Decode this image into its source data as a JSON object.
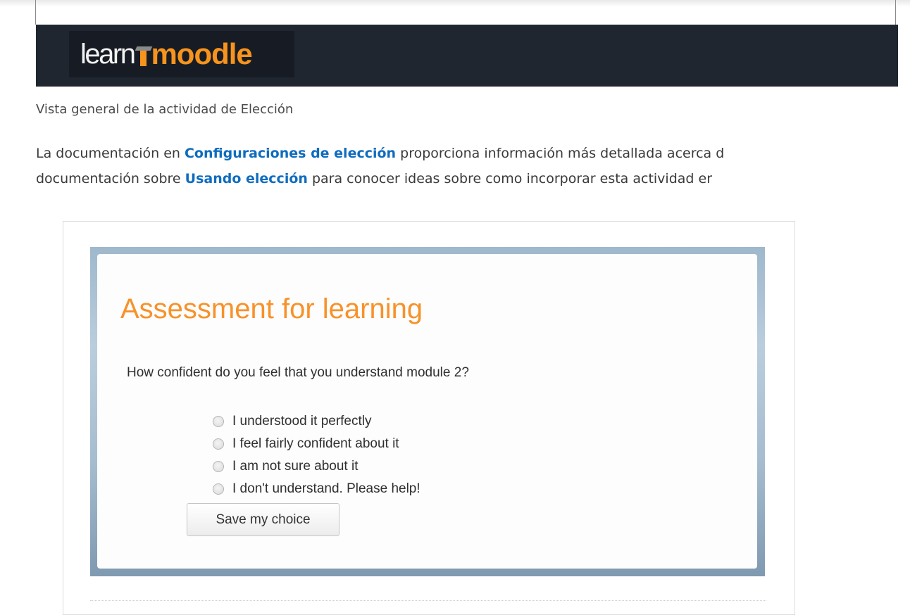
{
  "header": {
    "logo": {
      "learn": "learn",
      "moodle": "moodle"
    }
  },
  "intro": {
    "overview": "Vista general de la actividad de Elección",
    "para": {
      "p1": "La documentación en ",
      "link1": "Configuraciones de elección",
      "p2": " proporciona información más detallada acerca d",
      "p3": "documentación sobre ",
      "link2": "Usando elección",
      "p4": " para conocer ideas sobre como incorporar esta actividad er"
    }
  },
  "choice": {
    "title": "Assessment for learning",
    "question": "How confident do you feel that you understand module 2?",
    "options": [
      "I understood it perfectly",
      "I feel fairly confident about it",
      "I am not sure about it",
      "I don't understand. Please help!"
    ],
    "save_label": "Save my choice"
  },
  "colors": {
    "header_bg": "#1f2630",
    "accent_orange": "#f7941d",
    "link_blue": "#0f6cbf"
  }
}
